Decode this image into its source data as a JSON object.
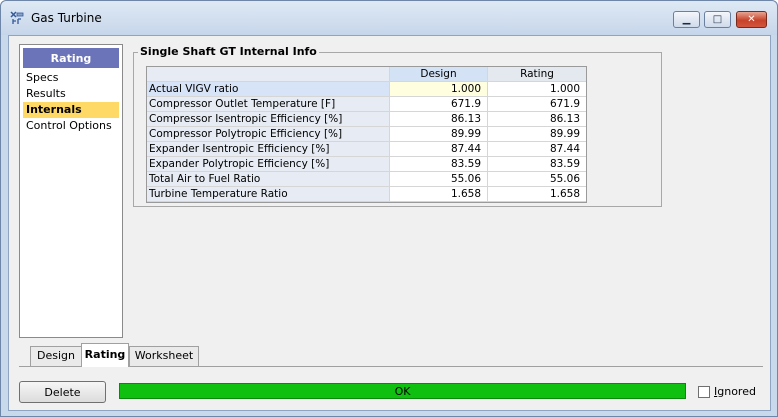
{
  "window": {
    "title": "Gas Turbine",
    "controls": {
      "minimize": "▁",
      "maximize": "□",
      "close": "✕"
    }
  },
  "nav": {
    "header": "Rating",
    "items": [
      {
        "label": "Specs",
        "selected": false
      },
      {
        "label": "Results",
        "selected": false
      },
      {
        "label": "Internals",
        "selected": true
      },
      {
        "label": "Control Options",
        "selected": false
      }
    ]
  },
  "group": {
    "title": "Single Shaft GT Internal Info",
    "columns": [
      "",
      "Design",
      "Rating"
    ],
    "rows": [
      {
        "name": "Actual VIGV ratio",
        "design": "1.000",
        "rating": "1.000"
      },
      {
        "name": "Compressor Outlet Temperature [F]",
        "design": "671.9",
        "rating": "671.9"
      },
      {
        "name": "Compressor Isentropic Efficiency [%]",
        "design": "86.13",
        "rating": "86.13"
      },
      {
        "name": "Compressor Polytropic Efficiency [%]",
        "design": "89.99",
        "rating": "89.99"
      },
      {
        "name": "Expander Isentropic Efficiency [%]",
        "design": "87.44",
        "rating": "87.44"
      },
      {
        "name": "Expander Polytropic Efficiency [%]",
        "design": "83.59",
        "rating": "83.59"
      },
      {
        "name": "Total Air to Fuel Ratio",
        "design": "55.06",
        "rating": "55.06"
      },
      {
        "name": "Turbine Temperature Ratio",
        "design": "1.658",
        "rating": "1.658"
      }
    ]
  },
  "tabs": [
    {
      "label": "Design",
      "active": false
    },
    {
      "label": "Rating",
      "active": true
    },
    {
      "label": "Worksheet",
      "active": false
    }
  ],
  "bottom": {
    "delete_label": "Delete",
    "status_text": "OK",
    "status_color": "#10c010",
    "ignored_first": "I",
    "ignored_rest": "gnored",
    "ignored_checked": false
  },
  "colors": {
    "nav_header": "#6b74b9",
    "nav_selected": "#ffd966",
    "status_ok": "#10c010"
  }
}
